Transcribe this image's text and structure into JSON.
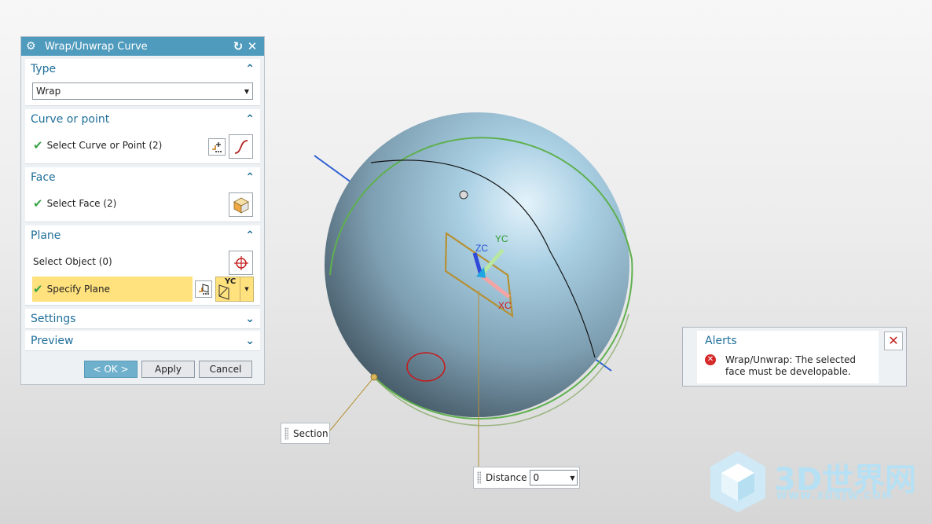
{
  "dialog": {
    "title": "Wrap/Unwrap Curve",
    "type": {
      "header": "Type",
      "selected": "Wrap"
    },
    "curve": {
      "header": "Curve or point",
      "select_label": "Select Curve or Point (2)"
    },
    "face": {
      "header": "Face",
      "select_label": "Select Face (2)"
    },
    "plane": {
      "header": "Plane",
      "select_object_label": "Select Object (0)",
      "specify_plane_label": "Specify Plane",
      "plane_icon_label": "YC"
    },
    "settings": {
      "header": "Settings"
    },
    "preview": {
      "header": "Preview"
    },
    "buttons": {
      "ok": "< OK >",
      "apply": "Apply",
      "cancel": "Cancel"
    }
  },
  "viewport": {
    "axis_labels": {
      "zc": "ZC",
      "yc": "YC",
      "xc": "XC"
    },
    "section_label": "Section",
    "distance_label": "Distance",
    "distance_value": "0"
  },
  "alerts": {
    "title": "Alerts",
    "message": "Wrap/Unwrap: The selected face must be developable."
  },
  "watermark": {
    "brand": "3D世界网",
    "url": "WWW.3DSJW.COM"
  },
  "colors": {
    "titlebar": "#4f9bbd",
    "section_header": "#1f6f9a",
    "check": "#3aa44a",
    "highlight": "#ffe17d",
    "sphere": "#8fb6cc",
    "error": "#d42a2a"
  }
}
